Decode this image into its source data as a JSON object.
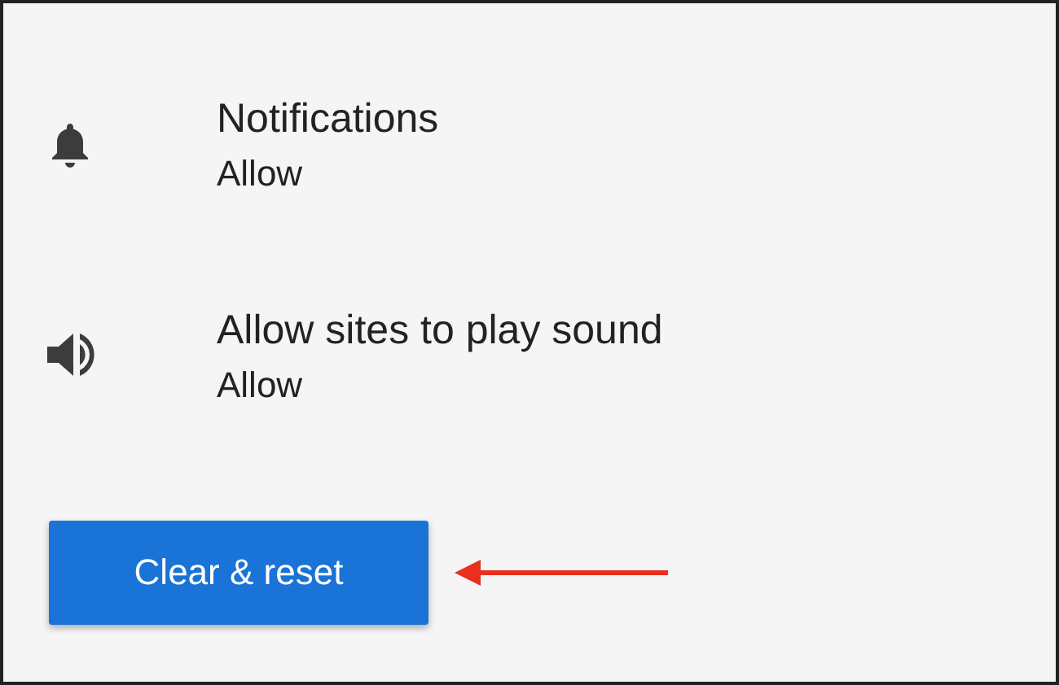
{
  "settings": [
    {
      "kind": "bell",
      "title": "Notifications",
      "value": "Allow"
    },
    {
      "kind": "sound",
      "title": "Allow sites to play sound",
      "value": "Allow"
    }
  ],
  "button": {
    "label": "Clear & reset"
  }
}
